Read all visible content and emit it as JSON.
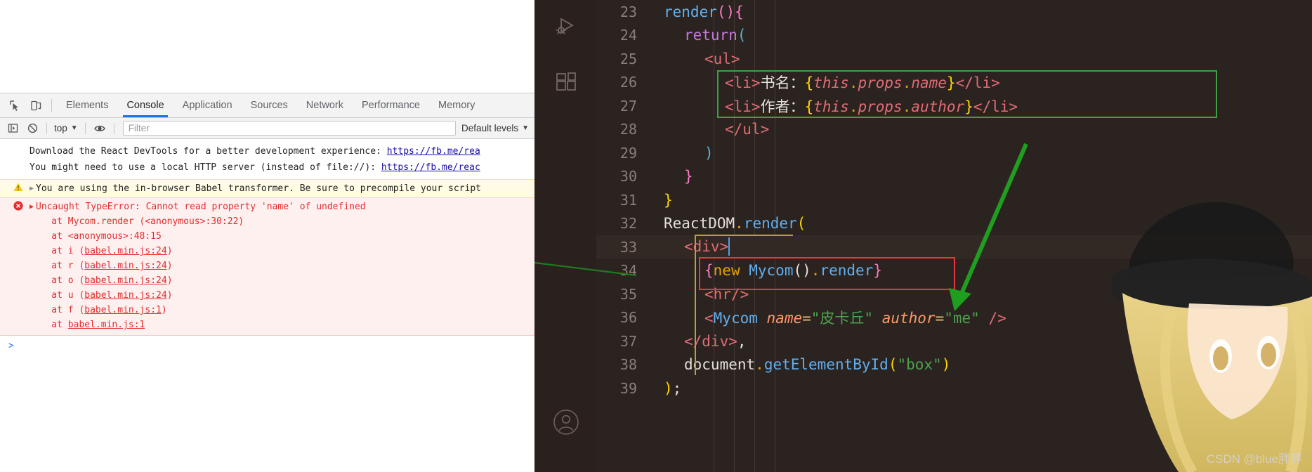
{
  "devtools": {
    "toolbar_icons": [
      {
        "name": "inspect-element-icon",
        "glyph": "inspect"
      },
      {
        "name": "device-toolbar-icon",
        "glyph": "device"
      }
    ],
    "tabs": [
      {
        "label": "Elements",
        "active": false
      },
      {
        "label": "Console",
        "active": true
      },
      {
        "label": "Application",
        "active": false
      },
      {
        "label": "Sources",
        "active": false
      },
      {
        "label": "Network",
        "active": false
      },
      {
        "label": "Performance",
        "active": false
      },
      {
        "label": "Memory",
        "active": false
      }
    ],
    "filterbar": {
      "sidebar_toggle_icon": "console-sidebar-icon",
      "clear_icon": "clear-console-icon",
      "context_label": "top",
      "eye_icon": "live-expression-icon",
      "filter_placeholder": "Filter",
      "filter_value": "",
      "levels_label": "Default levels"
    },
    "console": {
      "info_lines": [
        {
          "text": "Download the React DevTools for a better development experience: ",
          "link": "https://fb.me/rea"
        },
        {
          "text": "You might need to use a local HTTP server (instead of file://): ",
          "link": "https://fb.me/reac"
        }
      ],
      "warning": {
        "icon": "warning-triangle-icon",
        "text": "You are using the in-browser Babel transformer. Be sure to precompile your script"
      },
      "error": {
        "icon": "error-circle-icon",
        "title": "Uncaught TypeError: Cannot read property 'name' of undefined",
        "stack": [
          {
            "text": "    at Mycom.render (<anonymous>:30:22)",
            "link": ""
          },
          {
            "text": "    at <anonymous>:48:15",
            "link": ""
          },
          {
            "text": "    at i (",
            "link": "babel.min.js:24",
            "tail": ")"
          },
          {
            "text": "    at r (",
            "link": "babel.min.js:24",
            "tail": ")"
          },
          {
            "text": "    at o (",
            "link": "babel.min.js:24",
            "tail": ")"
          },
          {
            "text": "    at u (",
            "link": "babel.min.js:24",
            "tail": ")"
          },
          {
            "text": "    at f (",
            "link": "babel.min.js:1",
            "tail": ")"
          },
          {
            "text": "    at ",
            "link": "babel.min.js:1",
            "tail": ""
          }
        ]
      },
      "prompt_symbol": ">"
    }
  },
  "editor": {
    "activity_icons": [
      {
        "name": "run-and-debug-icon"
      },
      {
        "name": "extensions-icon"
      },
      {
        "name": "account-icon"
      }
    ],
    "lines": [
      {
        "n": "23",
        "indent": 0,
        "tokens": [
          {
            "t": "render",
            "c": "t-fn"
          },
          {
            "t": "()",
            "c": "t-brace-p"
          },
          {
            "t": "{",
            "c": "t-brace-p"
          }
        ]
      },
      {
        "n": "24",
        "indent": 1,
        "tokens": [
          {
            "t": "return",
            "c": "t-kw"
          },
          {
            "t": "(",
            "c": "t-brace-b"
          }
        ]
      },
      {
        "n": "25",
        "indent": 2,
        "tokens": [
          {
            "t": "<ul>",
            "c": "t-tag"
          }
        ]
      },
      {
        "n": "26",
        "indent": 3,
        "tokens": [
          {
            "t": "<li>",
            "c": "t-tag"
          },
          {
            "t": "书名：",
            "c": "t-white"
          },
          {
            "t": "{",
            "c": "t-brace-y"
          },
          {
            "t": "this",
            "c": "t-this"
          },
          {
            "t": ".",
            "c": "t-dot"
          },
          {
            "t": "props",
            "c": "t-this"
          },
          {
            "t": ".",
            "c": "t-dot"
          },
          {
            "t": "name",
            "c": "t-this"
          },
          {
            "t": "}",
            "c": "t-brace-y"
          },
          {
            "t": "</li>",
            "c": "t-tag"
          }
        ]
      },
      {
        "n": "27",
        "indent": 3,
        "tokens": [
          {
            "t": "<li>",
            "c": "t-tag"
          },
          {
            "t": "作者：",
            "c": "t-white"
          },
          {
            "t": "{",
            "c": "t-brace-y"
          },
          {
            "t": "this",
            "c": "t-this"
          },
          {
            "t": ".",
            "c": "t-dot"
          },
          {
            "t": "props",
            "c": "t-this"
          },
          {
            "t": ".",
            "c": "t-dot"
          },
          {
            "t": "author",
            "c": "t-this"
          },
          {
            "t": "}",
            "c": "t-brace-y"
          },
          {
            "t": "</li>",
            "c": "t-tag"
          }
        ]
      },
      {
        "n": "28",
        "indent": 3,
        "tokens": [
          {
            "t": "</ul>",
            "c": "t-tag"
          }
        ]
      },
      {
        "n": "29",
        "indent": 2,
        "tokens": [
          {
            "t": ")",
            "c": "t-brace-b"
          }
        ]
      },
      {
        "n": "30",
        "indent": 1,
        "tokens": [
          {
            "t": "}",
            "c": "t-brace-p"
          }
        ]
      },
      {
        "n": "31",
        "indent": 0,
        "tokens": [
          {
            "t": "}",
            "c": "t-brace-y"
          }
        ]
      },
      {
        "n": "32",
        "indent": 0,
        "tokens": [
          {
            "t": "ReactDOM",
            "c": "t-white"
          },
          {
            "t": ".",
            "c": "t-dot"
          },
          {
            "t": "render",
            "c": "t-fn"
          },
          {
            "t": "(",
            "c": "t-brace-y"
          }
        ]
      },
      {
        "n": "33",
        "indent": 1,
        "highlight": true,
        "cursor": true,
        "tokens": [
          {
            "t": "<div>",
            "c": "t-tag"
          }
        ]
      },
      {
        "n": "34",
        "indent": 2,
        "tokens": [
          {
            "t": "{",
            "c": "t-brace-p"
          },
          {
            "t": "new",
            "c": "t-kw2"
          },
          {
            "t": " ",
            "c": "t-plain"
          },
          {
            "t": "Mycom",
            "c": "t-fn"
          },
          {
            "t": "()",
            "c": "t-white"
          },
          {
            "t": ".",
            "c": "t-dot"
          },
          {
            "t": "render",
            "c": "t-fn"
          },
          {
            "t": "}",
            "c": "t-brace-p"
          }
        ]
      },
      {
        "n": "35",
        "indent": 2,
        "tokens": [
          {
            "t": "<hr/>",
            "c": "t-tag"
          }
        ]
      },
      {
        "n": "36",
        "indent": 2,
        "tokens": [
          {
            "t": "<",
            "c": "t-tag"
          },
          {
            "t": "Mycom",
            "c": "t-fn"
          },
          {
            "t": " ",
            "c": "t-plain"
          },
          {
            "t": "name",
            "c": "t-attr"
          },
          {
            "t": "=",
            "c": "t-eq"
          },
          {
            "t": "\"皮卡丘\"",
            "c": "t-str"
          },
          {
            "t": " ",
            "c": "t-plain"
          },
          {
            "t": "author",
            "c": "t-attr"
          },
          {
            "t": "=",
            "c": "t-eq"
          },
          {
            "t": "\"me\"",
            "c": "t-str"
          },
          {
            "t": " ",
            "c": "t-plain"
          },
          {
            "t": "/>",
            "c": "t-tag"
          }
        ]
      },
      {
        "n": "37",
        "indent": 1,
        "tokens": [
          {
            "t": "</div>",
            "c": "t-tag"
          },
          {
            "t": ",",
            "c": "t-white"
          }
        ]
      },
      {
        "n": "38",
        "indent": 1,
        "tokens": [
          {
            "t": "document",
            "c": "t-white"
          },
          {
            "t": ".",
            "c": "t-dot"
          },
          {
            "t": "getElementById",
            "c": "t-fn"
          },
          {
            "t": "(",
            "c": "t-brace-y"
          },
          {
            "t": "\"box\"",
            "c": "t-str"
          },
          {
            "t": ")",
            "c": "t-brace-y"
          }
        ]
      },
      {
        "n": "39",
        "indent": 0,
        "tokens": [
          {
            "t": ")",
            "c": "t-brace-y"
          },
          {
            "t": ";",
            "c": "t-white"
          }
        ]
      }
    ]
  },
  "watermark": "CSDN @blue胖胖",
  "colors": {
    "accent_blue": "#1a73e8",
    "error_red": "#e32d2d",
    "warn_yellow": "#fffbe5",
    "anno_green": "#3fa03f",
    "anno_red": "#e03a3a",
    "editor_bg": "#2b2320"
  }
}
